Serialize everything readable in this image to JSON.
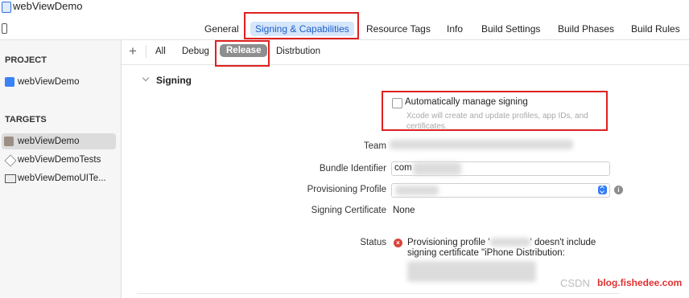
{
  "window": {
    "title": "webViewDemo"
  },
  "tabs": [
    {
      "label": "General"
    },
    {
      "label": "Signing & Capabilities"
    },
    {
      "label": "Resource Tags"
    },
    {
      "label": "Info"
    },
    {
      "label": "Build Settings"
    },
    {
      "label": "Build Phases"
    },
    {
      "label": "Build Rules"
    }
  ],
  "sidebar": {
    "project_header": "PROJECT",
    "project_item": "webViewDemo",
    "targets_header": "TARGETS",
    "targets": [
      {
        "label": "webViewDemo",
        "icon": "app-target-icon"
      },
      {
        "label": "webViewDemoTests",
        "icon": "test-target-icon"
      },
      {
        "label": "webViewDemoUITe...",
        "icon": "uitest-target-icon"
      }
    ]
  },
  "config_bar": {
    "add": "+",
    "items": [
      "All",
      "Debug",
      "Release",
      "Distrbution"
    ],
    "selected": "Release"
  },
  "signing": {
    "section_title": "Signing",
    "auto_manage_label": "Automatically manage signing",
    "auto_manage_checked": false,
    "auto_manage_hint": "Xcode will create and update profiles, app IDs, and certificates.",
    "team_label": "Team",
    "bundle_id_label": "Bundle Identifier",
    "bundle_id_value": "com",
    "profile_label": "Provisioning Profile",
    "cert_label": "Signing Certificate",
    "cert_value": "None",
    "status_label": "Status",
    "status_line1": "Provisioning profile '",
    "status_line1_end": "' doesn't include",
    "status_line2": "signing certificate \"iPhone Distribution:"
  },
  "watermark": {
    "csdn": "CSDN",
    "site": "blog.fishedee.com"
  },
  "colors": {
    "accent": "#1d5fcc",
    "highlight": "#e02020",
    "error": "#d9443a"
  }
}
